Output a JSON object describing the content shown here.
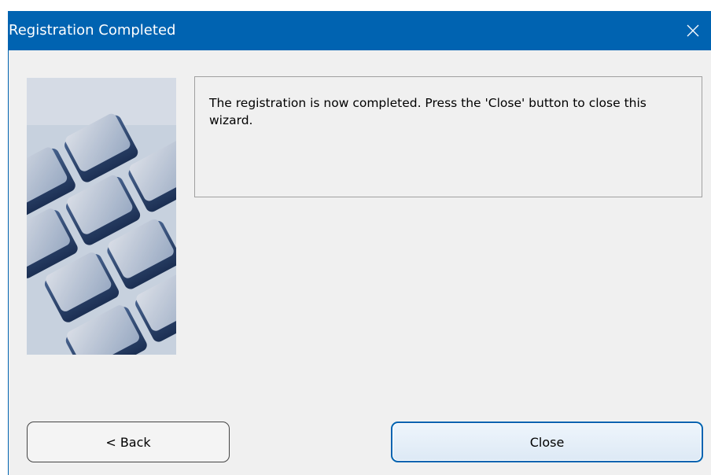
{
  "window": {
    "title": "Registration Completed",
    "close_icon": "close-icon"
  },
  "message": {
    "text": "The registration is now completed. Press the 'Close' button to close this wizard."
  },
  "image": {
    "icon": "keyboard-image"
  },
  "buttons": {
    "back_label": "< Back",
    "close_label": "Close"
  },
  "colors": {
    "titlebar": "#0063b1",
    "background": "#f0f0f0",
    "focus_border": "#0063b1"
  }
}
